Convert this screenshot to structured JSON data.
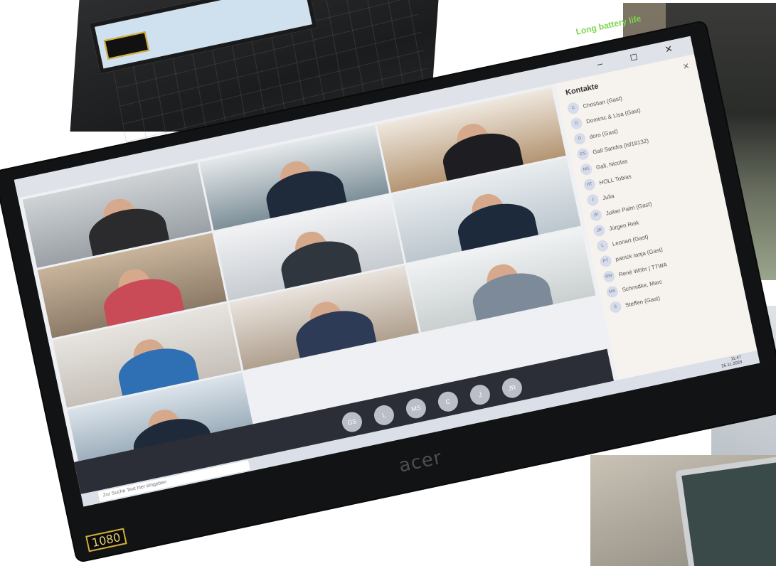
{
  "photo": {
    "battery_label": "Long battery life",
    "brand": "acer",
    "hd_badge": "1080",
    "top_badge": "1080"
  },
  "window": {
    "controls": "–  ◻  ✕"
  },
  "contacts_panel": {
    "title": "Kontakte",
    "close": "✕",
    "items": [
      {
        "initials": "C",
        "name": "Christian (Gast)"
      },
      {
        "initials": "D",
        "name": "Dominic & Lisa (Gast)"
      },
      {
        "initials": "D",
        "name": "doro (Gast)"
      },
      {
        "initials": "GS",
        "name": "Gall Sandra (lsf18132)"
      },
      {
        "initials": "NG",
        "name": "Gall, Nicolas"
      },
      {
        "initials": "HT",
        "name": "HOLL Tobias"
      },
      {
        "initials": "J",
        "name": "Julia"
      },
      {
        "initials": "JP",
        "name": "Julian Palm (Gast)"
      },
      {
        "initials": "JR",
        "name": "Jürgen Reik"
      },
      {
        "initials": "L",
        "name": "Leonart (Gast)"
      },
      {
        "initials": "PT",
        "name": "patrick tanja (Gast)"
      },
      {
        "initials": "RW",
        "name": "René Wöhr | TTWA"
      },
      {
        "initials": "MS",
        "name": "Schmidke, Marc"
      },
      {
        "initials": "S",
        "name": "Steffen (Gast)"
      }
    ]
  },
  "call_bar": {
    "avatars": [
      "GS",
      "L",
      "MS",
      "C",
      "J",
      "JR"
    ]
  },
  "taskbar": {
    "search_placeholder": "Zur Suche Text hier eingeben",
    "time": "11:47",
    "date": "26.11.2020"
  },
  "colors": {
    "bezel": "#121315",
    "screen": "#eef0f3",
    "badge_gold": "#cfae3a",
    "battery_green": "#7bd64a"
  }
}
